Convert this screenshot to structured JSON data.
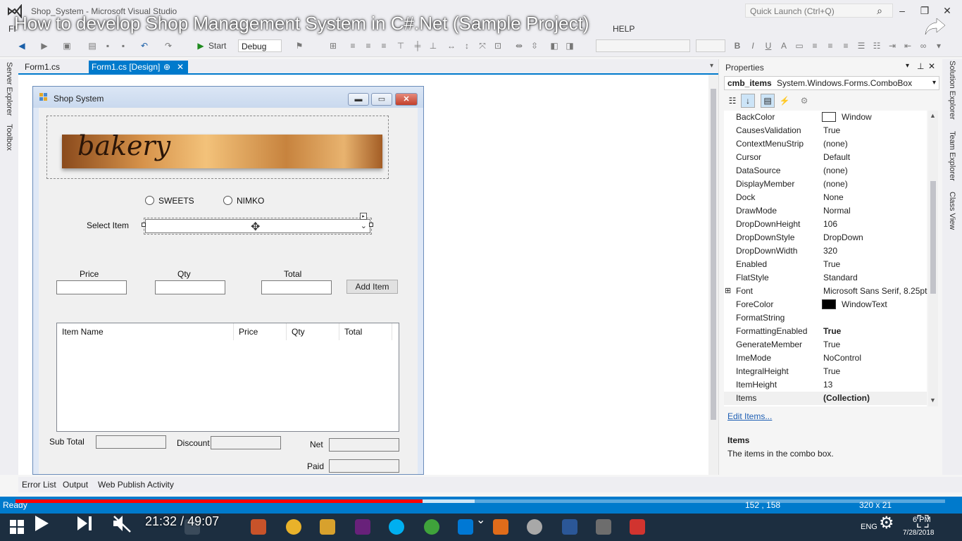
{
  "window": {
    "title": "Shop_System - Microsoft Visual Studio",
    "quick_launch": "Quick Launch (Ctrl+Q)"
  },
  "video": {
    "title": "How to develop Shop Management System in C#.Net (Sample Project)",
    "current_time": "21:32",
    "separator": "/",
    "duration": "49:07",
    "progress": 0.438
  },
  "menu": {
    "items": [
      "FI",
      "HELP"
    ]
  },
  "toolbar": {
    "start_label": "Start",
    "config": "Debug"
  },
  "sidebar_left": [
    "Server Explorer",
    "Toolbox"
  ],
  "tabs": [
    {
      "label": "Form1.cs"
    },
    {
      "label": "Form1.cs [Design]",
      "pin": "⊕",
      "close": "✕"
    }
  ],
  "form": {
    "title": "Shop System",
    "banner_text": "bakery",
    "radio_sweets": "SWEETS",
    "radio_nimko": "NIMKO",
    "select_item_label": "Select Item",
    "price_label": "Price",
    "qty_label": "Qty",
    "total_label": "Total",
    "add_item": "Add Item",
    "listview_columns": [
      "Item Name",
      "Price",
      "Qty",
      "Total"
    ],
    "subtotal_label": "Sub Total",
    "discount_label": "Discount",
    "net_label": "Net",
    "paid_label": "Paid"
  },
  "properties": {
    "title": "Properties",
    "object_name": "cmb_items",
    "object_type": "System.Windows.Forms.ComboBox",
    "rows": [
      {
        "name": "BackColor",
        "value": "Window",
        "swatch": "#ffffff"
      },
      {
        "name": "CausesValidation",
        "value": "True"
      },
      {
        "name": "ContextMenuStrip",
        "value": "(none)"
      },
      {
        "name": "Cursor",
        "value": "Default"
      },
      {
        "name": "DataSource",
        "value": "(none)"
      },
      {
        "name": "DisplayMember",
        "value": "(none)"
      },
      {
        "name": "Dock",
        "value": "None"
      },
      {
        "name": "DrawMode",
        "value": "Normal"
      },
      {
        "name": "DropDownHeight",
        "value": "106"
      },
      {
        "name": "DropDownStyle",
        "value": "DropDown"
      },
      {
        "name": "DropDownWidth",
        "value": "320"
      },
      {
        "name": "Enabled",
        "value": "True"
      },
      {
        "name": "FlatStyle",
        "value": "Standard"
      },
      {
        "name": "Font",
        "value": "Microsoft Sans Serif, 8.25pt",
        "expander": "⊞"
      },
      {
        "name": "ForeColor",
        "value": "WindowText",
        "swatch": "#000000"
      },
      {
        "name": "FormatString",
        "value": ""
      },
      {
        "name": "FormattingEnabled",
        "value": "True",
        "bold": true
      },
      {
        "name": "GenerateMember",
        "value": "True"
      },
      {
        "name": "ImeMode",
        "value": "NoControl"
      },
      {
        "name": "IntegralHeight",
        "value": "True"
      },
      {
        "name": "ItemHeight",
        "value": "13"
      },
      {
        "name": "Items",
        "value": "(Collection)",
        "bold": true
      }
    ],
    "edit_link": "Edit Items...",
    "desc_title": "Items",
    "desc_text": "The items in the combo box."
  },
  "sidebar_right": [
    "Solution Explorer",
    "Team Explorer",
    "Class View"
  ],
  "bottom_tabs": [
    "Error List",
    "Output",
    "Web Publish Activity"
  ],
  "status": {
    "text": "Ready",
    "position": "152 , 158",
    "size": "320 x 21"
  },
  "taskbar": {
    "lang": "ENG",
    "time": "6 PM",
    "date": "7/28/2018"
  },
  "colors": {
    "accent": "#007acc",
    "progress": "#ff0000"
  }
}
